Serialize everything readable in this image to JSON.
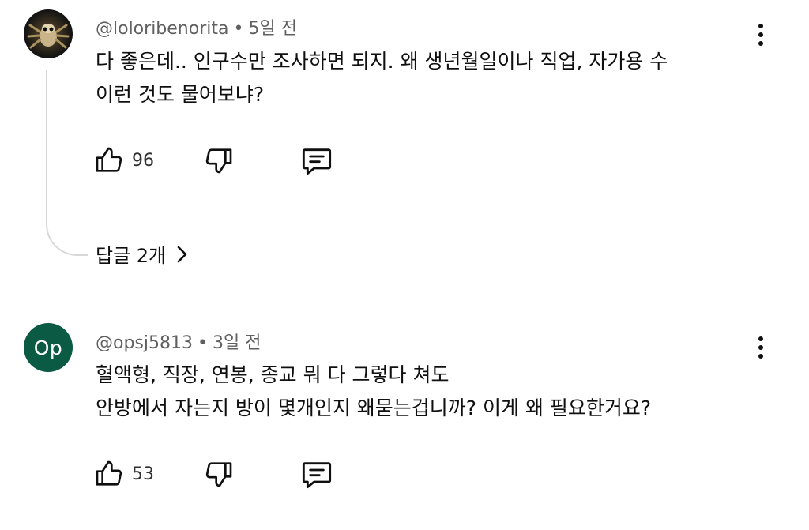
{
  "comments": [
    {
      "handle": "@loloribenorita",
      "separator": "•",
      "time": "5일 전",
      "lines": [
        "다 좋은데.. 인구수만 조사하면 되지. 왜 생년월일이나 직업, 자가용 수",
        "이런 것도 물어보냐?"
      ],
      "likes": "96",
      "replies_label": "답글 2개"
    },
    {
      "handle": "@opsj5813",
      "separator": "•",
      "time": "3일 전",
      "avatar_initials": "Op",
      "avatar_color": "#0b5a43",
      "lines": [
        "혈액형, 직장, 연봉, 종교 뭐 다 그렇다 쳐도",
        "안방에서 자는지 방이 몇개인지 왜묻는겁니까? 이게 왜 필요한거요?"
      ],
      "likes": "53"
    }
  ],
  "icons": {
    "like": "thumbs-up-icon",
    "dislike": "thumbs-down-icon",
    "reply": "comment-icon",
    "more": "more-vertical-icon",
    "chevron": "chevron-right-icon"
  }
}
